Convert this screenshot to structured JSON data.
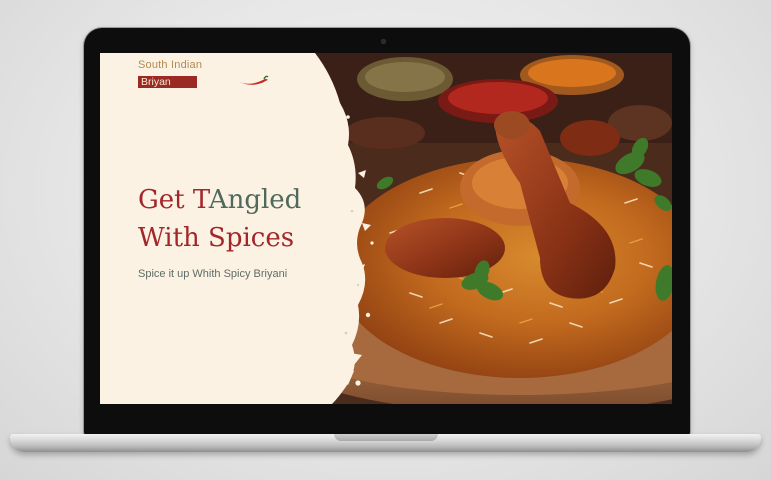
{
  "brand": {
    "line1": "South Indian",
    "line2": "Briyan",
    "accent_color": "#9b2a25",
    "gold_color": "#b5894e"
  },
  "hero": {
    "headline_line1_part1": "Get T",
    "headline_line1_part2": "Angled",
    "headline_line2": "With Spices",
    "subline": "Spice it up Whith Spicy Briyani",
    "headline_color": "#a3262a",
    "headline_alt_color": "#4f6a5c",
    "background_color": "#fbf2e4",
    "image_icon": "biryani-chicken-photo"
  }
}
